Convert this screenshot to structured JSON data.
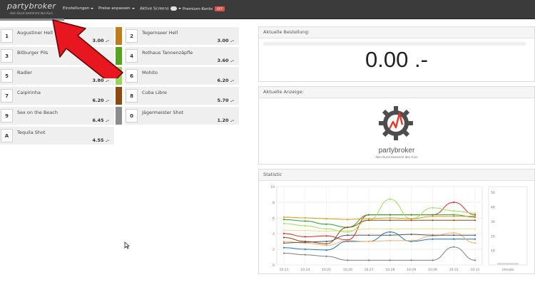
{
  "brand": {
    "name": "partybroker",
    "slogan": "dein Durst bestimmt den Kurs"
  },
  "nav": {
    "settings": "Einstellungen",
    "prices": "Preise anpassen",
    "screens": "Aktive Screens",
    "premium": "Premium-Konto",
    "premium_badge": "OFF"
  },
  "drinks_left": [
    {
      "key": "1",
      "name": "Augustiner Hell",
      "price": "3.00 .-"
    },
    {
      "key": "3",
      "name": "Bitburger Pils",
      "price": "3.00 .-"
    },
    {
      "key": "5",
      "name": "Radler",
      "price": "3.80 .-"
    },
    {
      "key": "7",
      "name": "Caipirinha",
      "price": "6.20 .-"
    },
    {
      "key": "9",
      "name": "Sex on the Beach",
      "price": "6.45 .-"
    },
    {
      "key": "A",
      "name": "Tequila Shot",
      "price": "4.55 .-"
    }
  ],
  "drinks_right": [
    {
      "key": "2",
      "name": "Tegernseer Hell",
      "price": "3.00 .-",
      "color": "#c07d1c"
    },
    {
      "key": "4",
      "name": "Rothaus Tannenzäpfle",
      "price": "3.60 .-",
      "color": "#55a31f"
    },
    {
      "key": "6",
      "name": "Mohito",
      "price": "6.20 .-",
      "color": "#98d45a"
    },
    {
      "key": "8",
      "name": "Cuba Libre",
      "price": "5.70 .-",
      "color": "#8a4a12"
    },
    {
      "key": "0",
      "name": "Jägermeister Shot",
      "price": "1.20 .-",
      "color": "#8c8c8c"
    }
  ],
  "panels": {
    "order": {
      "title": "Aktuelle Bestellung:",
      "total": "0.00 .-"
    },
    "display": {
      "title": "Aktuelle Anzeige:",
      "logo_text": "partybroker",
      "logo_slogan": "dein Durst bestimmt den Kurs"
    },
    "stats": {
      "title": "Statistic"
    }
  },
  "chart_data": {
    "type": "line",
    "x": [
      "10:23",
      "10:24",
      "10:25",
      "10:26",
      "10:27",
      "10:28",
      "10:29",
      "10:30",
      "10:31",
      "10:31"
    ],
    "ylim": [
      0,
      10
    ],
    "yticks": [
      0,
      2,
      4,
      6,
      8,
      10
    ],
    "series": [
      {
        "color": "#d62728",
        "values": [
          4.0,
          3.6,
          3.7,
          3.2,
          6.4,
          6.4,
          6.4,
          6.4,
          8.0,
          6.4
        ]
      },
      {
        "color": "#2ca02c",
        "values": [
          5.8,
          5.6,
          5.2,
          4.8,
          6.4,
          6.4,
          6.4,
          6.4,
          6.4,
          6.1
        ]
      },
      {
        "color": "#9be05a",
        "values": [
          5.3,
          5.0,
          4.6,
          4.2,
          5.7,
          8.4,
          5.9,
          7.3,
          6.9,
          6.6
        ]
      },
      {
        "color": "#d4a017",
        "values": [
          6.1,
          6.0,
          5.9,
          5.8,
          5.9,
          6.0,
          5.9,
          6.2,
          6.2,
          6.2
        ]
      },
      {
        "color": "#e5e08a",
        "values": [
          4.4,
          4.4,
          4.3,
          4.4,
          4.6,
          4.6,
          4.6,
          4.6,
          4.6,
          4.6
        ]
      },
      {
        "color": "#8a4a12",
        "values": [
          3.5,
          3.0,
          2.7,
          4.8,
          5.7,
          5.7,
          5.7,
          5.7,
          5.7,
          5.7
        ]
      },
      {
        "color": "#1f77b4",
        "values": [
          2.2,
          2.0,
          1.9,
          3.0,
          3.0,
          4.2,
          3.0,
          3.3,
          3.3,
          3.3
        ]
      },
      {
        "color": "#f0b070",
        "values": [
          3.0,
          2.8,
          2.5,
          3.1,
          3.0,
          3.1,
          3.1,
          3.7,
          4.1,
          2.8
        ]
      },
      {
        "color": "#555555",
        "values": [
          2.8,
          2.9,
          3.0,
          3.8,
          3.8,
          3.8,
          3.9,
          3.8,
          3.8,
          3.8
        ]
      },
      {
        "color": "#7f7f7f",
        "values": [
          1.5,
          1.3,
          1.1,
          0.6,
          0.6,
          0.6,
          0.6,
          0.6,
          2.3,
          0.6
        ]
      }
    ],
    "volume_axis": {
      "ticks": [
        10,
        20,
        30,
        40,
        50
      ],
      "label": "Umsatz"
    }
  }
}
